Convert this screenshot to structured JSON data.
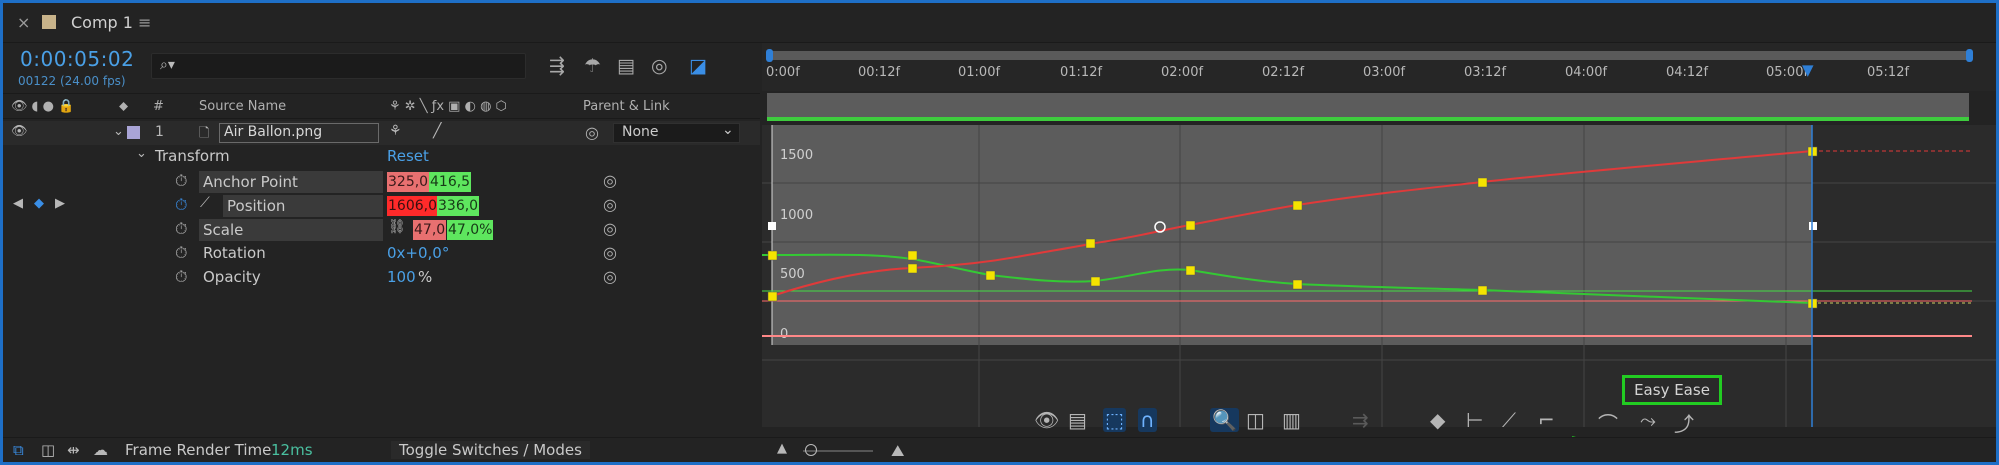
{
  "tab": {
    "close": "×",
    "title": "Comp 1",
    "menu": "≡"
  },
  "header": {
    "timecode": "0:00:05:02",
    "frame_info": "00122 (24.00 fps)",
    "search_icon": "search-icon"
  },
  "columns": {
    "num": "#",
    "source_name": "Source Name",
    "parent_link": "Parent & Link"
  },
  "layer": {
    "index": "1",
    "name": "Air Ballon.png",
    "parent": "None"
  },
  "transform": {
    "label": "Transform",
    "reset": "Reset"
  },
  "properties": [
    {
      "name": "Anchor Point",
      "x": "325,0",
      "y": "416,5"
    },
    {
      "name": "Position",
      "x": "1606,0",
      "y": "336,0"
    },
    {
      "name": "Scale",
      "x": "47,0",
      "y": "47,0%"
    },
    {
      "name": "Rotation",
      "value": "0x+0,0°"
    },
    {
      "name": "Opacity",
      "value": "100",
      "unit": "%"
    }
  ],
  "footer": {
    "render_label": "Frame Render Time",
    "render_value": "12ms",
    "toggle": "Toggle Switches / Modes"
  },
  "ruler": {
    "labels": [
      "0:00f",
      "00:12f",
      "01:00f",
      "01:12f",
      "02:00f",
      "02:12f",
      "03:00f",
      "03:12f",
      "04:00f",
      "04:12f",
      "05:00f",
      "05:12f"
    ]
  },
  "graph": {
    "y_labels": [
      "1500",
      "1000",
      "500",
      "0"
    ]
  },
  "tooltip": {
    "easy_ease": "Easy Ease"
  },
  "colors": {
    "accent": "#2f7fd6",
    "red_curve": "#e03a3a",
    "green_curve": "#34c934",
    "keyframe": "#f5e400",
    "annotation": "#22cc22"
  }
}
